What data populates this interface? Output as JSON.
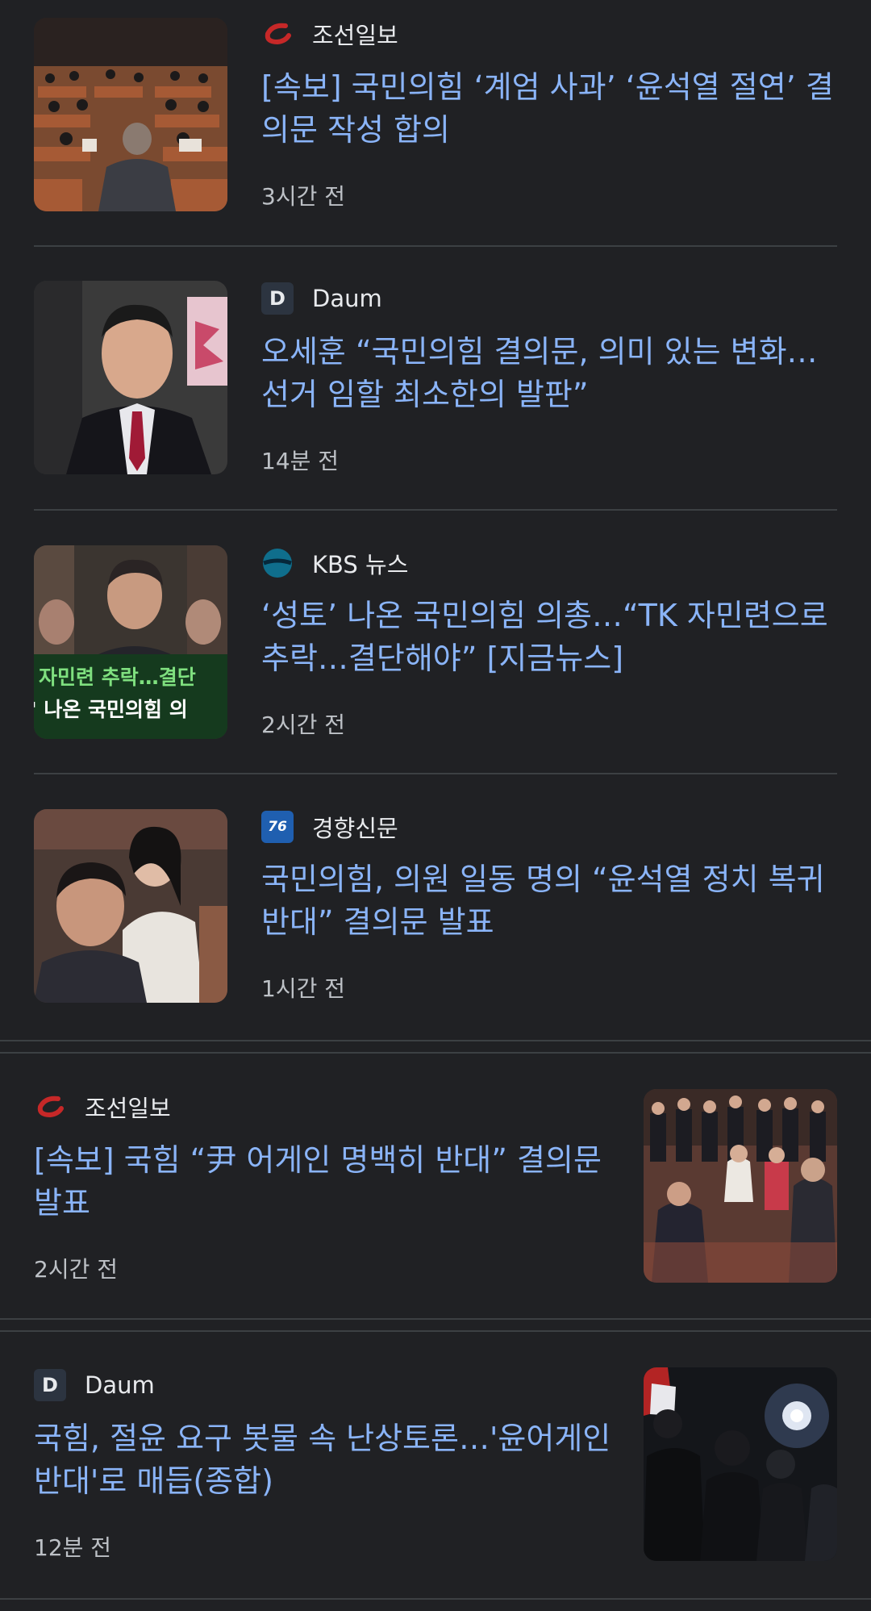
{
  "feed": {
    "items": [
      {
        "source": "조선일보",
        "source_logo": "chosun-logo-icon",
        "headline": "[속보] 국민의힘 ‘계엄 사과’ ‘윤석열 절연’ 결의문 작성 합의",
        "time": "3시간 전",
        "thumbnail": "assembly-hall-photo"
      },
      {
        "source": "Daum",
        "source_logo": "daum-logo-icon",
        "headline": "오세훈 “국민의힘 결의문, 의미 있는 변화…선거 임할 최소한의 발판”",
        "time": "14분 전",
        "thumbnail": "politician-portrait-photo"
      },
      {
        "source": "KBS 뉴스",
        "source_logo": "kbs-logo-icon",
        "headline": "‘성토’ 나온 국민의힘 의총…“TK 자민련으로 추락…결단해야” [지금뉴스]",
        "time": "2시간 전",
        "thumbnail": "news-video-still",
        "thumbnail_caption_line1": "자민련 추락…결단",
        "thumbnail_caption_line2": "' 나온 국민의힘 의"
      },
      {
        "source": "경향신문",
        "source_logo": "kyunghyang-logo-icon",
        "headline": "국민의힘, 의원 일동 명의 “윤석열 정치 복귀 반대” 결의문 발표",
        "time": "1시간 전",
        "thumbnail": "lawmakers-seated-photo"
      },
      {
        "source": "조선일보",
        "source_logo": "chosun-logo-icon",
        "headline": "[속보] 국힘 “尹 어게인 명백히 반대” 결의문 발표",
        "time": "2시간 전",
        "thumbnail": "lawmakers-standing-photo"
      },
      {
        "source": "Daum",
        "source_logo": "daum-logo-icon",
        "headline": "국힘, 절윤 요구 봇물 속 난상토론…'윤어게인 반대'로 매듭(종합)",
        "time": "12분 전",
        "thumbnail": "press-flash-photo"
      }
    ]
  },
  "colors": {
    "background": "#202124",
    "headline": "#8ab4f8",
    "source_text": "#e8eaed",
    "time_text": "#bdc1c6",
    "divider": "#3c4043"
  }
}
